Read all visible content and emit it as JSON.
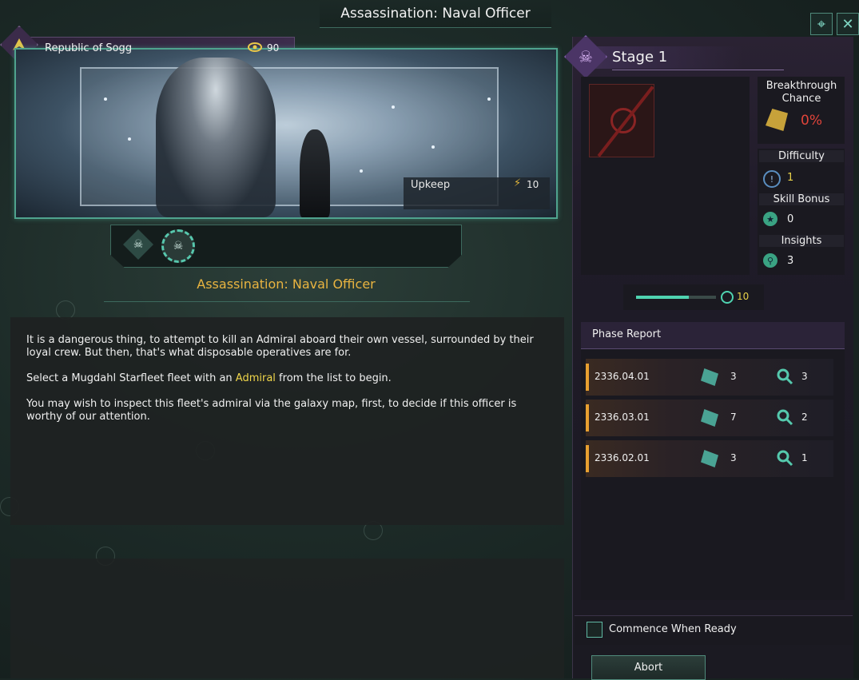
{
  "window": {
    "title": "Assassination: Naval Officer"
  },
  "header": {
    "empire_name": "Republic of Sogg",
    "intel_value": "90"
  },
  "portrait": {
    "upkeep_label": "Upkeep",
    "upkeep_value": "10"
  },
  "operation": {
    "subtitle": "Assassination: Naval Officer",
    "description": {
      "p1": "It is a dangerous thing, to attempt to kill an Admiral aboard their own vessel, surrounded by their loyal crew. But then, that's what disposable operatives are for.",
      "p2_before": "Select a Mugdahl Starfleet fleet with an ",
      "p2_highlight": "Admiral",
      "p2_after": " from the list to begin.",
      "p3": "You may wish to inspect this fleet's admiral via the galaxy map, first, to decide if this officer is worthy of our attention."
    }
  },
  "stage": {
    "label": "Stage 1",
    "breakthrough_label": "Breakthrough Chance",
    "breakthrough_value": "0%",
    "difficulty_label": "Difficulty",
    "difficulty_value": "1",
    "skill_bonus_label": "Skill Bonus",
    "skill_bonus_value": "0",
    "insights_label": "Insights",
    "insights_value": "3",
    "progress_value": "10",
    "progress_fraction": 0.66
  },
  "phase_report": {
    "header": "Phase Report",
    "rows": [
      {
        "date": "2336.04.01",
        "infiltration": "3",
        "insights": "3"
      },
      {
        "date": "2336.03.01",
        "infiltration": "7",
        "insights": "2"
      },
      {
        "date": "2336.02.01",
        "infiltration": "3",
        "insights": "1"
      }
    ]
  },
  "footer": {
    "commence_label": "Commence When Ready",
    "abort_label": "Abort"
  },
  "icons": {
    "intel": "eye-icon",
    "upkeep": "energy-bolt-icon",
    "stage": "skull-icon",
    "close": "close-icon",
    "camera": "camera-target-icon"
  },
  "colors": {
    "accent_teal": "#4fd3b0",
    "highlight_gold": "#e9b440",
    "breakthrough_red": "#e0443a",
    "difficulty_yellow": "#e8d24a"
  }
}
